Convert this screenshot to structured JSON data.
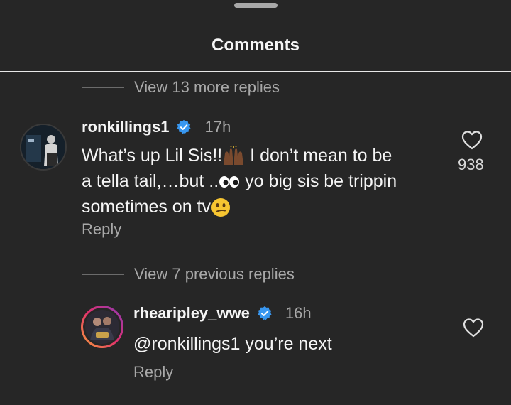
{
  "sheet": {
    "title": "Comments"
  },
  "thread1": {
    "view_more": "View 13 more replies"
  },
  "comment1": {
    "username": "ronkillings1",
    "time": "17h",
    "text_line1_a": "What’s up Lil Sis!!",
    "text_line1_b": " I don’t mean to be",
    "text_line2_a": "a tella tail,…but ..",
    "text_line2_b": " yo big sis be trippin",
    "text_line3_a": "sometimes on tv",
    "emojis": [
      "raising-hands-emoji",
      "eyes-emoji",
      "confused-face-emoji"
    ],
    "reply": "Reply",
    "likes": "938",
    "verified": true
  },
  "thread2": {
    "view_previous": "View 7 previous replies"
  },
  "comment2": {
    "username": "rhearipley_wwe",
    "time": "16h",
    "text": "@ronkillings1 you’re next",
    "reply": "Reply",
    "verified": true
  },
  "colors": {
    "background": "#262626",
    "primary_text": "#f5f5f5",
    "secondary_text": "#a8a8a8",
    "verified_blue": "#3897f0",
    "emoji_yellow": "#f7c531"
  }
}
